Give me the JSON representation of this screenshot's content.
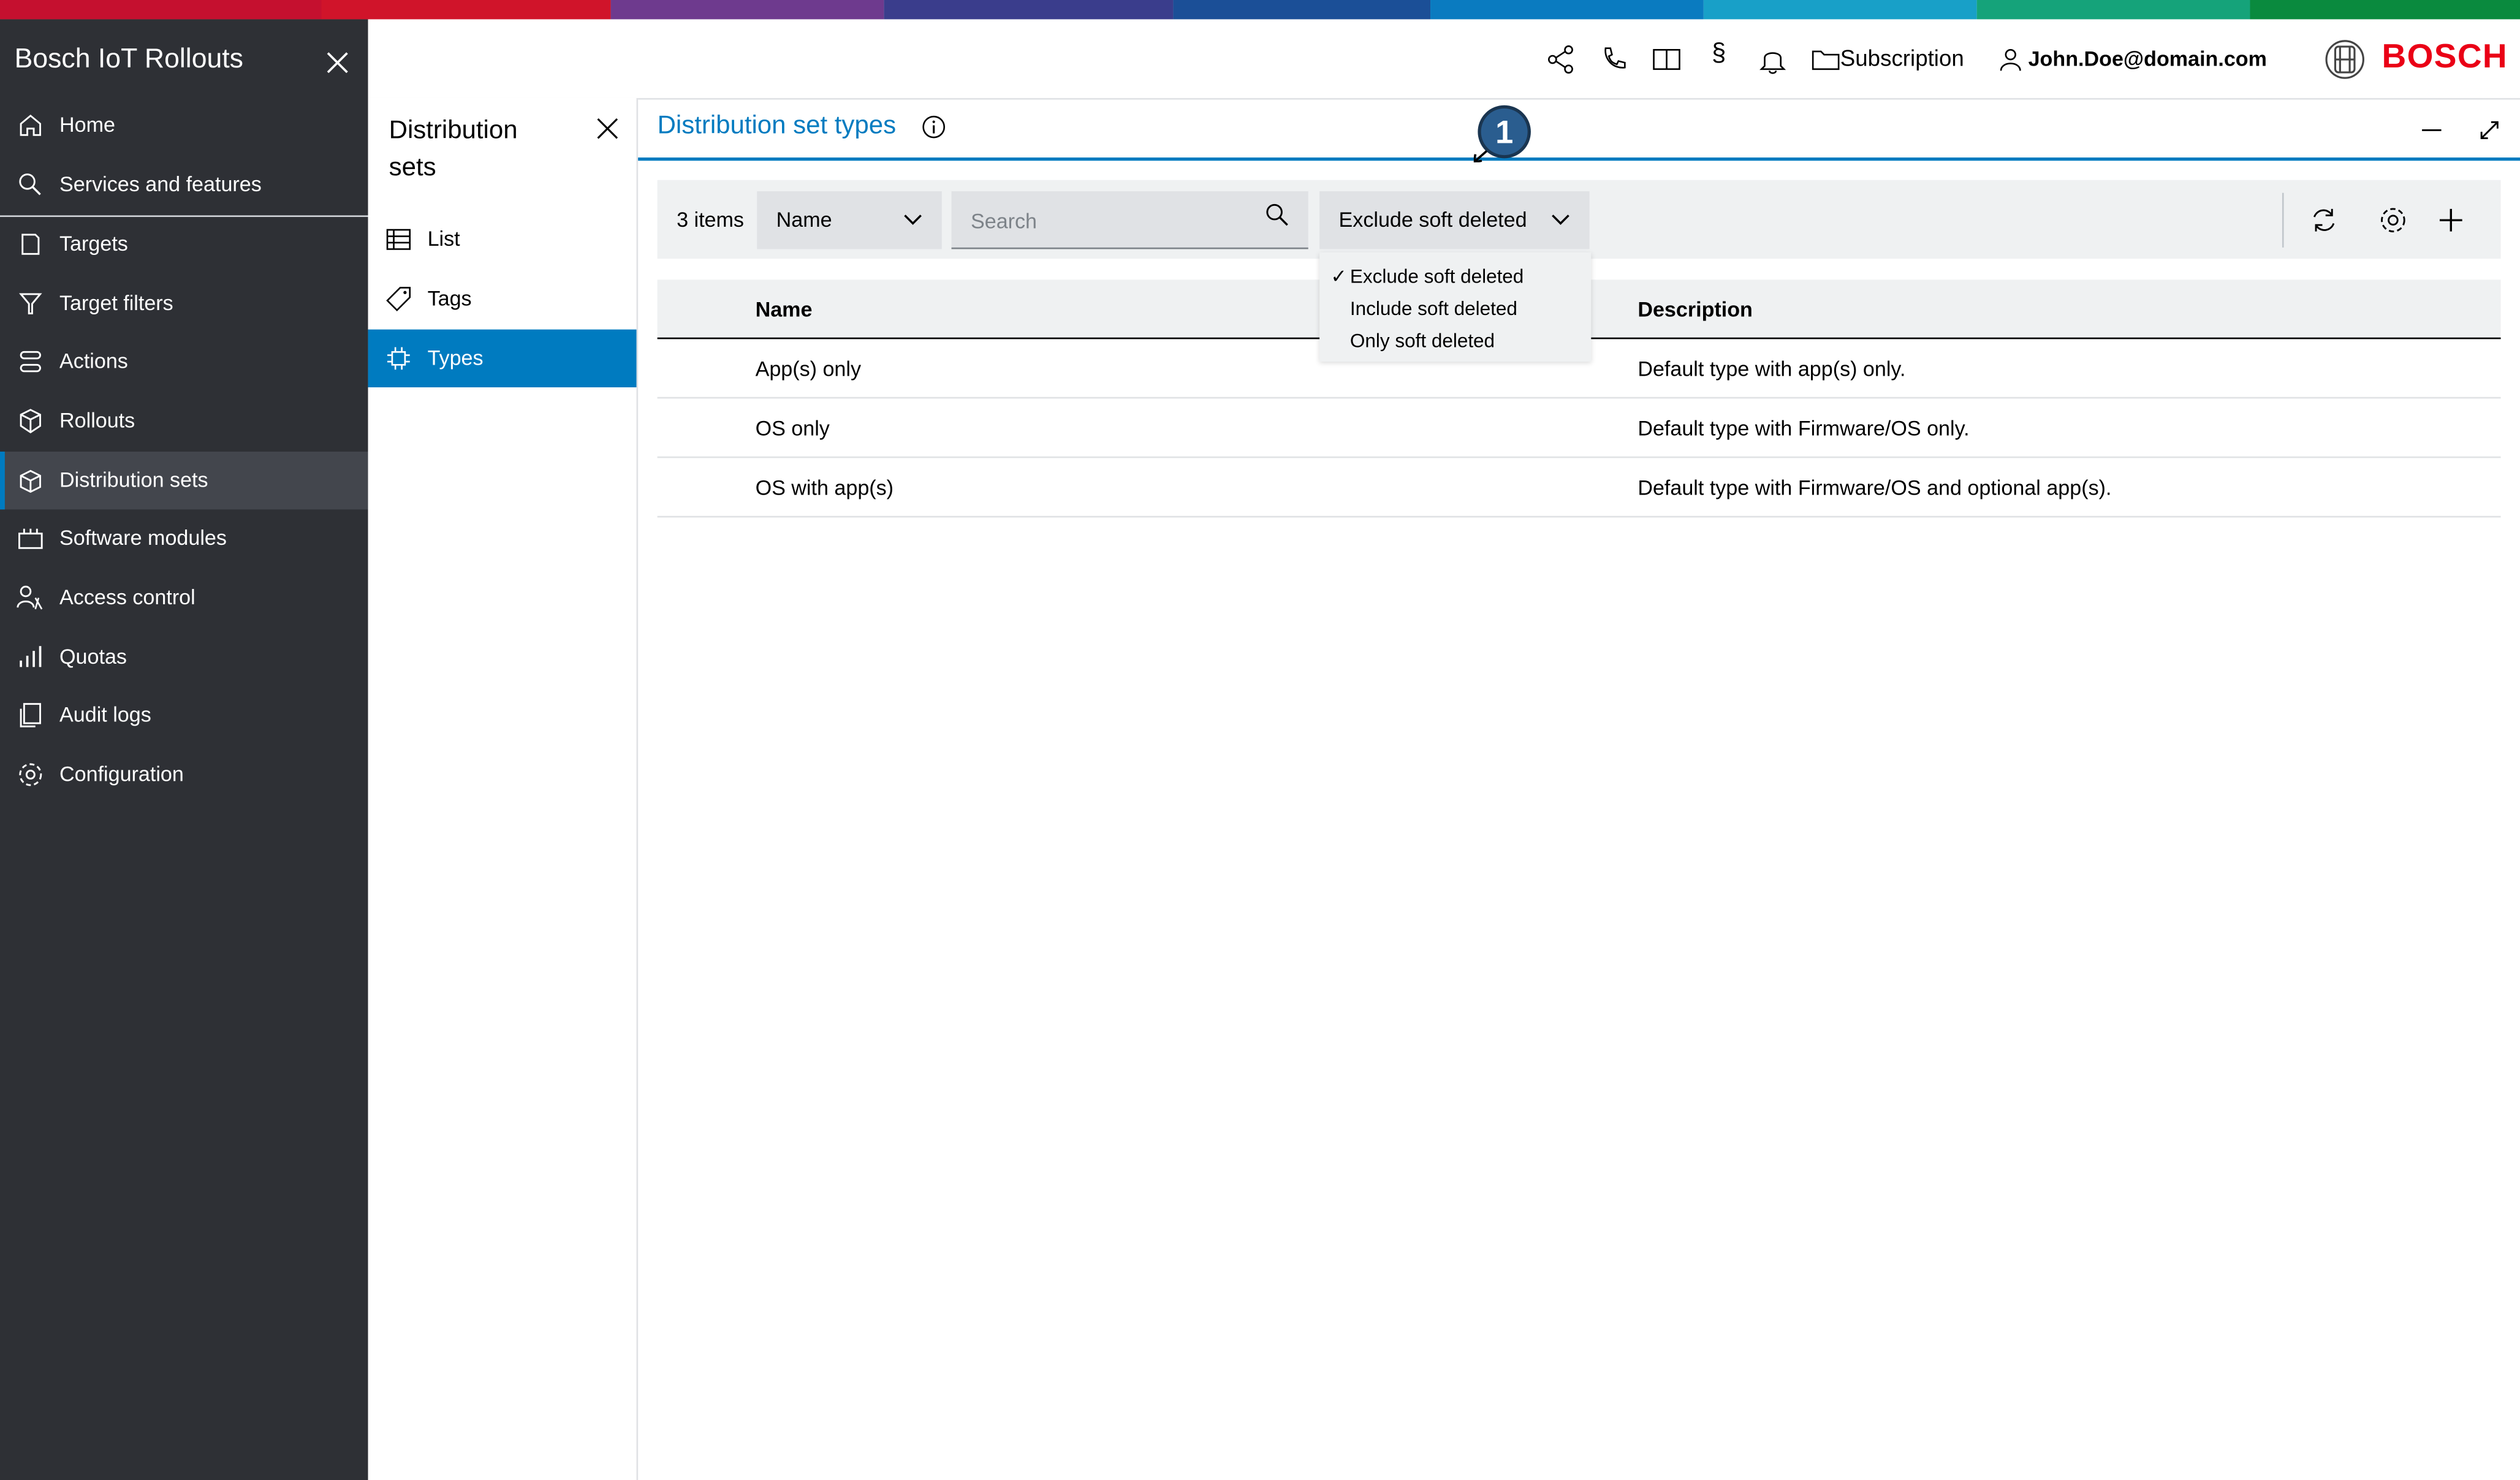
{
  "app": {
    "title": "Bosch IoT Rollouts",
    "brand": "BOSCH",
    "brand_color": "#ea0016",
    "accent_color": "#007bc0"
  },
  "nav": {
    "items": [
      {
        "label": "Home",
        "icon": "home-icon"
      },
      {
        "label": "Services and features",
        "icon": "search-icon"
      },
      {
        "label": "Targets",
        "icon": "device-icon"
      },
      {
        "label": "Target filters",
        "icon": "filter-icon"
      },
      {
        "label": "Actions",
        "icon": "actions-icon"
      },
      {
        "label": "Rollouts",
        "icon": "box-icon"
      },
      {
        "label": "Distribution sets",
        "icon": "package-icon"
      },
      {
        "label": "Software modules",
        "icon": "modules-icon"
      },
      {
        "label": "Access control",
        "icon": "user-lock-icon"
      },
      {
        "label": "Quotas",
        "icon": "bar-chart-icon"
      },
      {
        "label": "Audit logs",
        "icon": "documents-icon"
      },
      {
        "label": "Configuration",
        "icon": "gear-icon"
      }
    ],
    "active": "Distribution sets"
  },
  "header": {
    "subscription_label": "Subscription",
    "user_label": "John.Doe@domain.com",
    "icons": [
      "share-icon",
      "phone-icon",
      "book-icon",
      "paragraph-icon",
      "bell-icon",
      "folder-icon",
      "user-icon"
    ]
  },
  "subnav": {
    "title": "Distribution sets",
    "items": [
      {
        "label": "List",
        "icon": "list-icon"
      },
      {
        "label": "Tags",
        "icon": "tag-icon"
      },
      {
        "label": "Types",
        "icon": "chip-icon"
      }
    ],
    "active": "Types"
  },
  "main": {
    "title": "Distribution set types",
    "toolbar": {
      "items_count": "3 items",
      "sort_select": "Name",
      "search_placeholder": "Search",
      "filter_select": "Exclude soft deleted"
    },
    "filter_options": [
      {
        "label": "Exclude soft deleted",
        "checked": true
      },
      {
        "label": "Include soft deleted",
        "checked": false
      },
      {
        "label": "Only soft deleted",
        "checked": false
      }
    ],
    "table": {
      "columns": [
        "Name",
        "Description"
      ],
      "rows": [
        {
          "name": "App(s) only",
          "description": "Default type with app(s) only."
        },
        {
          "name": "OS only",
          "description": "Default type with Firmware/OS only."
        },
        {
          "name": "OS with app(s)",
          "description": "Default type with Firmware/OS and optional app(s)."
        }
      ]
    }
  },
  "callout": {
    "label": "1"
  }
}
